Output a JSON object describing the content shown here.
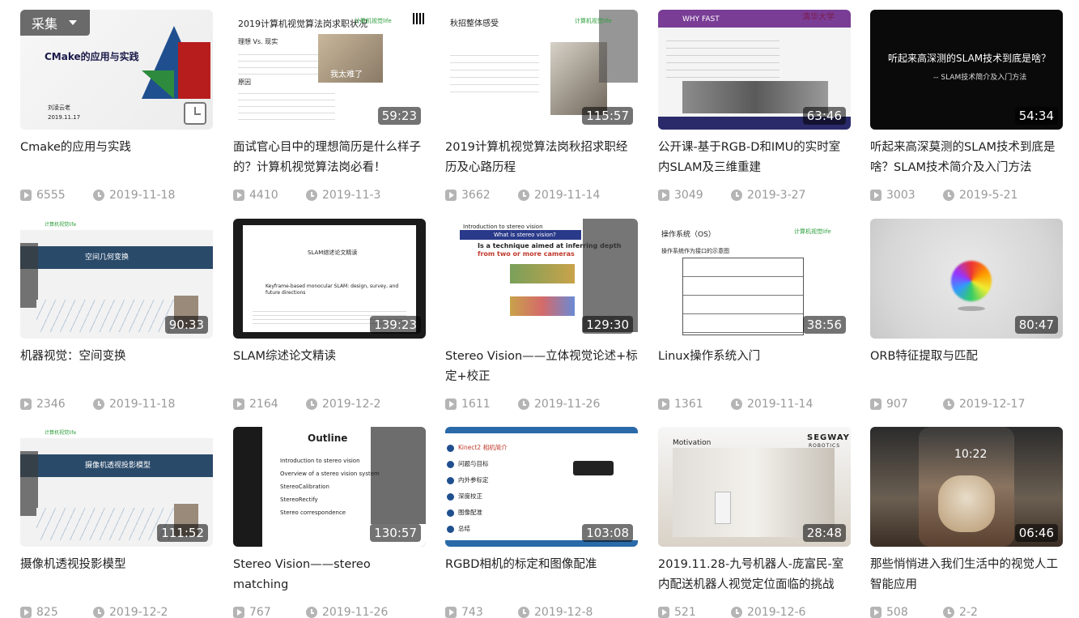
{
  "ui": {
    "collect_label": "采集"
  },
  "videos": [
    {
      "title": "Cmake的应用与实践",
      "duration": "",
      "plays": "6555",
      "date": "2019-11-18",
      "thumb_text": [
        "CMake的应用与实践",
        "刘凌云老",
        "2019.11.17"
      ]
    },
    {
      "title": "面试官心目中的理想简历是什么样子的？计算机视觉算法岗必看！",
      "duration": "59:23",
      "plays": "4410",
      "date": "2019-11-3",
      "thumb_text": [
        "2019计算机视觉算法岗求职状况",
        "理想 Vs. 现实",
        "我太难了",
        "原因",
        "计算机视觉life"
      ]
    },
    {
      "title": "2019计算机视觉算法岗秋招求职经历及心路历程",
      "duration": "115:57",
      "plays": "3662",
      "date": "2019-11-14",
      "thumb_text": [
        "秋招整体感受",
        "计算机视觉life"
      ]
    },
    {
      "title": "公开课-基于RGB-D和IMU的实时室内SLAM及三维重建",
      "duration": "63:46",
      "plays": "3049",
      "date": "2019-3-27",
      "thumb_text": [
        "WHY FAST",
        "清华大学"
      ]
    },
    {
      "title": "听起来高深莫测的SLAM技术到底是啥？SLAM技术简介及入门方法",
      "duration": "54:34",
      "plays": "3003",
      "date": "2019-5-21",
      "thumb_text": [
        "听起来高深测的SLAM技术到底是啥？",
        "-- SLAM技术简介及入门方法"
      ]
    },
    {
      "title": "机器视觉：空间变换",
      "duration": "90:33",
      "plays": "2346",
      "date": "2019-11-18",
      "thumb_text": [
        "空间几何变换",
        "计算机视觉life"
      ]
    },
    {
      "title": "SLAM综述论文精读",
      "duration": "139:23",
      "plays": "2164",
      "date": "2019-12-2",
      "thumb_text": [
        "SLAM综述论文精读",
        "Keyframe-based monocular SLAM: design, survey, and future directions"
      ]
    },
    {
      "title": "Stereo Vision——立体视觉论述+标定+校正",
      "duration": "129:30",
      "plays": "1611",
      "date": "2019-11-26",
      "thumb_text": [
        "Introduction to stereo vision",
        "What is stereo vision?",
        "Is a technique aimed at inferring depth",
        "from two or more cameras"
      ]
    },
    {
      "title": "Linux操作系统入门",
      "duration": "38:56",
      "plays": "1361",
      "date": "2019-11-14",
      "thumb_text": [
        "操作系统（OS）",
        "操作系统作为接口的示意图",
        "计算机视觉life"
      ]
    },
    {
      "title": "ORB特征提取与匹配",
      "duration": "80:47",
      "plays": "907",
      "date": "2019-12-17",
      "thumb_text": []
    },
    {
      "title": "摄像机透视投影模型",
      "duration": "111:52",
      "plays": "825",
      "date": "2019-12-2",
      "thumb_text": [
        "摄像机透视投影模型",
        "计算机视觉life"
      ]
    },
    {
      "title": "Stereo Vision——stereo matching",
      "duration": "130:57",
      "plays": "767",
      "date": "2019-11-26",
      "thumb_text": [
        "Outline",
        "Introduction to stereo vision",
        "Overview of a stereo vision system",
        "StereoCalibration",
        "StereoRectify",
        "Stereo correspondence"
      ]
    },
    {
      "title": "RGBD相机的标定和图像配准",
      "duration": "103:08",
      "plays": "743",
      "date": "2019-12-8",
      "thumb_text": [
        "Kinect2 相机简介",
        "问题与目标",
        "内外参标定",
        "深度校正",
        "图像配准",
        "总结"
      ]
    },
    {
      "title": "2019.11.28-九号机器人-庞富民-室内配送机器人视觉定位面临的挑战",
      "duration": "28:48",
      "plays": "521",
      "date": "2019-12-6",
      "thumb_text": [
        "Motivation",
        "SEGWAY",
        "ROBOTICS"
      ]
    },
    {
      "title": "那些悄悄进入我们生活中的视觉人工智能应用",
      "duration": "06:46",
      "plays": "508",
      "date": "2-2",
      "thumb_text": [
        "10:22"
      ]
    }
  ]
}
